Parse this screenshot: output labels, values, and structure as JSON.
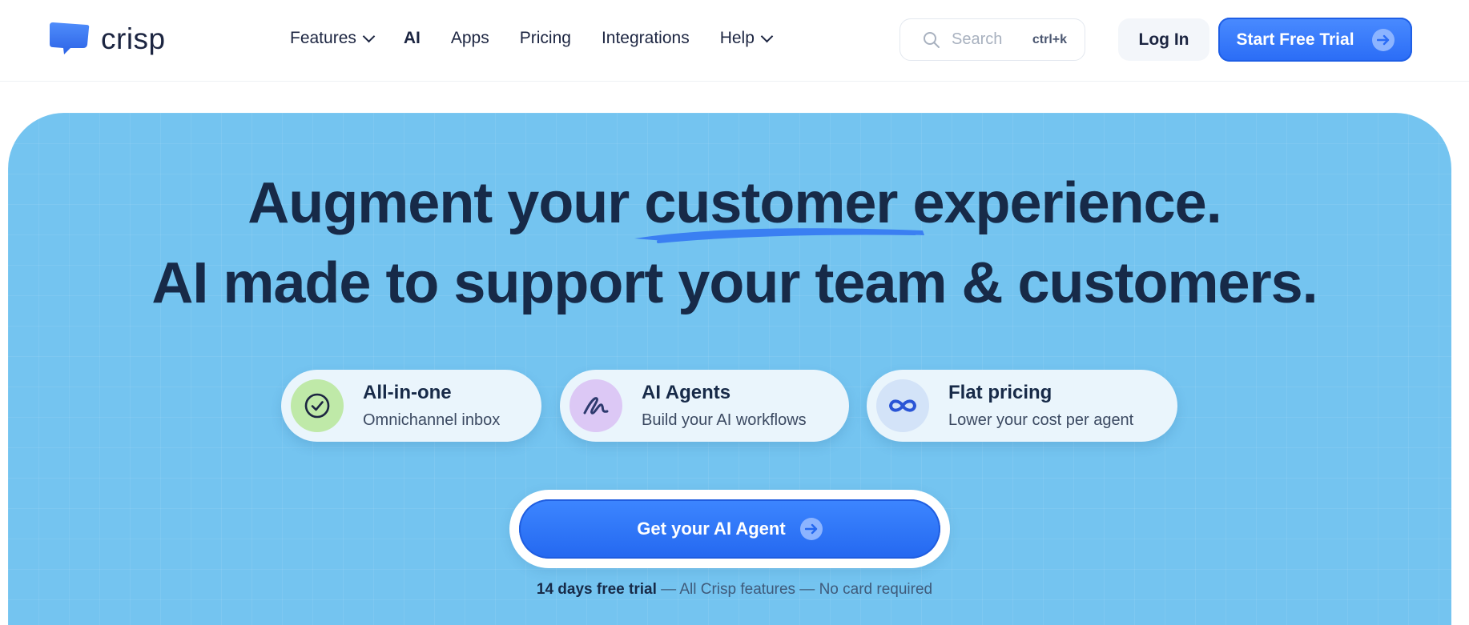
{
  "brand": {
    "name": "crisp"
  },
  "nav": {
    "items": [
      {
        "label": "Features",
        "dropdown": true
      },
      {
        "label": "AI",
        "dropdown": false
      },
      {
        "label": "Apps",
        "dropdown": false
      },
      {
        "label": "Pricing",
        "dropdown": false
      },
      {
        "label": "Integrations",
        "dropdown": false
      },
      {
        "label": "Help",
        "dropdown": true
      }
    ]
  },
  "search": {
    "placeholder": "Search",
    "shortcut": "ctrl+k"
  },
  "actions": {
    "login_label": "Log In",
    "trial_label": "Start Free Trial"
  },
  "hero": {
    "headline_line1_before": "Augment your",
    "headline_line1_highlight": "customer",
    "headline_line1_after": "experience.",
    "headline_line2": "AI made to support your team & customers.",
    "features": [
      {
        "title": "All-in-one",
        "subtitle": "Omnichannel inbox",
        "icon": "check-circle-icon",
        "icon_bg": "#bfe9a8"
      },
      {
        "title": "AI Agents",
        "subtitle": "Build your AI workflows",
        "icon": "scribble-icon",
        "icon_bg": "#dcc8f5"
      },
      {
        "title": "Flat pricing",
        "subtitle": "Lower your cost per agent",
        "icon": "infinity-icon",
        "icon_bg": "#d3e3f8"
      }
    ],
    "cta_label": "Get your AI Agent",
    "footnote_bold": "14 days free trial",
    "footnote_rest": " — All Crisp features — No card required"
  },
  "colors": {
    "hero_bg": "#74c4f0",
    "primary": "#2a6cf6",
    "text_dark": "#172a48",
    "underline": "#3a7ff2"
  }
}
